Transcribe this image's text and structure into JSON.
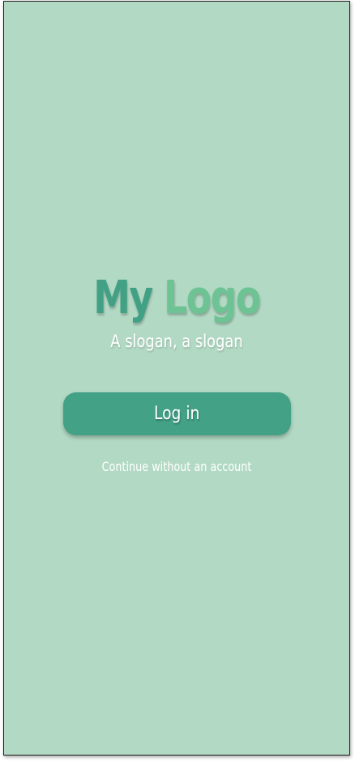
{
  "logo": {
    "word1": "My",
    "word2": "Logo",
    "color_word1": "#42a184",
    "color_word2": "#6ec394"
  },
  "slogan": "A slogan, a slogan",
  "login_button": {
    "label": "Log in",
    "color": "#43a185"
  },
  "guest_link": "Continue without an account",
  "background_color": "#b2d9c4"
}
